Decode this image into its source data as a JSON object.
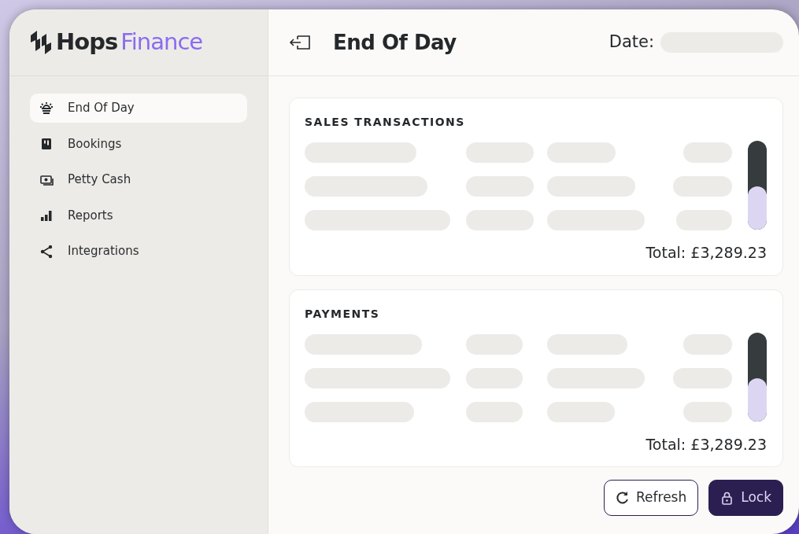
{
  "brand": {
    "name": "Hops",
    "suffix": "Finance"
  },
  "sidebar": {
    "items": [
      {
        "label": "End Of Day",
        "kind": "sun",
        "selected": true
      },
      {
        "label": "Bookings",
        "kind": "booking",
        "selected": false
      },
      {
        "label": "Petty Cash",
        "kind": "cash",
        "selected": false
      },
      {
        "label": "Reports",
        "kind": "bars",
        "selected": false
      },
      {
        "label": "Integrations",
        "kind": "share",
        "selected": false
      }
    ]
  },
  "header": {
    "title": "End Of Day",
    "date_label": "Date:",
    "date_loading": true
  },
  "sections": [
    {
      "title": "SALES TRANSACTIONS",
      "loading": true,
      "total": "Total: £3,289.23"
    },
    {
      "title": "PAYMENTS",
      "loading": true,
      "total": "Total: £3,289.23"
    }
  ],
  "buttons": [
    {
      "label": "Refresh",
      "kind": "outline"
    },
    {
      "label": "Lock",
      "kind": "primary"
    }
  ]
}
